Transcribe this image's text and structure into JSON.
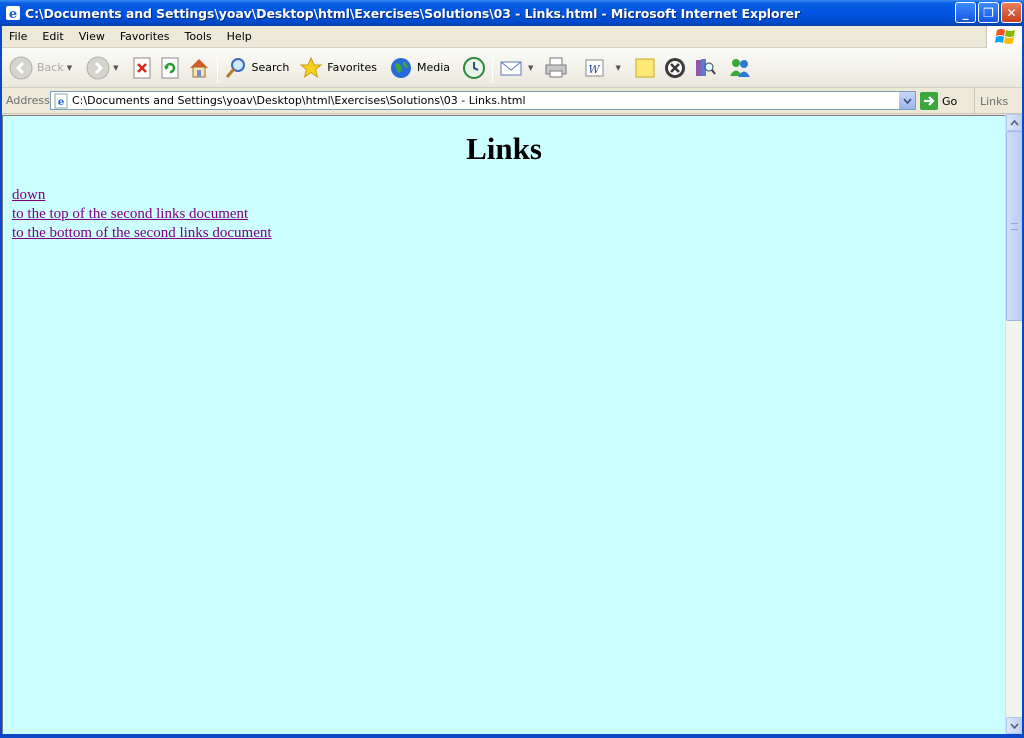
{
  "window": {
    "title": "C:\\Documents and Settings\\yoav\\Desktop\\html\\Exercises\\Solutions\\03 - Links.html - Microsoft Internet Explorer",
    "app_icon": "ie-icon",
    "minimize_glyph": "_",
    "maximize_glyph": "❐",
    "close_glyph": "✕"
  },
  "menu": {
    "items": [
      "File",
      "Edit",
      "View",
      "Favorites",
      "Tools",
      "Help"
    ]
  },
  "toolbar": {
    "back_label": "Back",
    "search_label": "Search",
    "favorites_label": "Favorites",
    "media_label": "Media"
  },
  "address": {
    "label": "Address",
    "url": "C:\\Documents and Settings\\yoav\\Desktop\\html\\Exercises\\Solutions\\03 - Links.html",
    "go_label": "Go",
    "links_label": "Links",
    "links_chevron": "»"
  },
  "page": {
    "background": "#ccffff",
    "link_color": "#800080",
    "heading": "Links",
    "links": [
      "down",
      "to the top of the second links document",
      "to the bottom of the second links document"
    ]
  }
}
